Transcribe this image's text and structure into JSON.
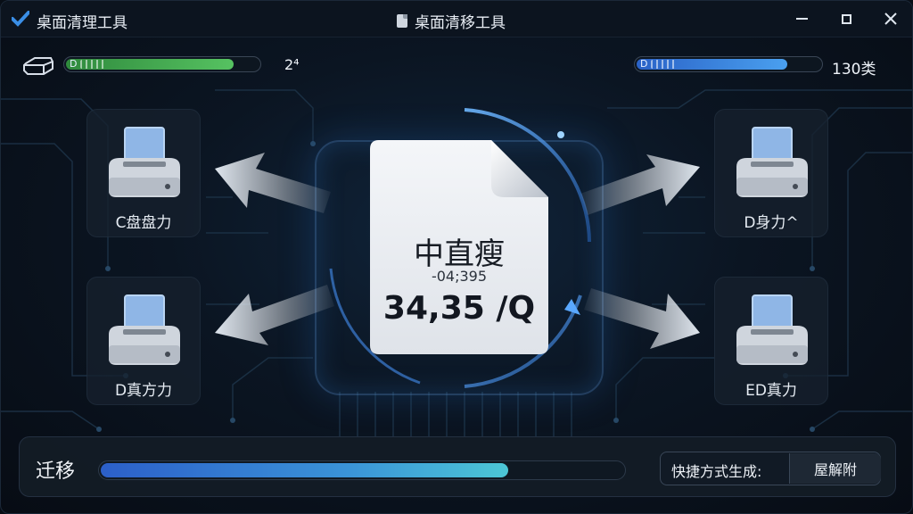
{
  "window": {
    "app_title": "桌面清理工具",
    "doc_title": "桌面清移工具"
  },
  "status": {
    "left_bar_label": "D",
    "left_count": "2⁴",
    "left_progress": 0.87,
    "right_bar_label": "D",
    "right_count": "130类",
    "right_progress": 0.82
  },
  "drives": [
    {
      "label": "C盘盘力"
    },
    {
      "label": "D真方力"
    },
    {
      "label": "D身力^"
    },
    {
      "label": "ED真力"
    }
  ],
  "center_doc": {
    "title": "中直瘦",
    "subtitle": "-04;395",
    "value": "34,35 /Q"
  },
  "bottom": {
    "migrate_label": "迁移",
    "migrate_progress": 0.78,
    "shortcut_label": "快捷方式生成:",
    "shortcut_button": "屋解附"
  },
  "colors": {
    "accent_blue": "#3a93d8",
    "accent_green": "#56c261",
    "background": "#0b1522"
  }
}
